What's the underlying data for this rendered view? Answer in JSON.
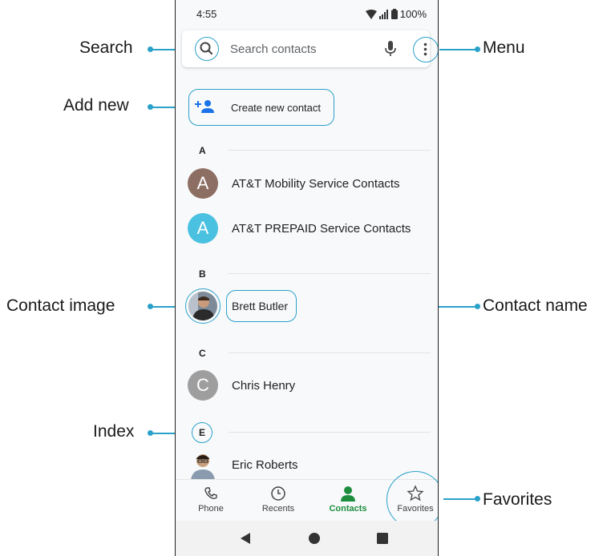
{
  "status_bar": {
    "time": "4:55",
    "battery": "100%"
  },
  "search": {
    "placeholder": "Search contacts"
  },
  "create_contact": {
    "label": "Create new contact"
  },
  "sections": [
    {
      "letter": "A",
      "contacts": [
        {
          "name": "AT&T Mobility Service Contacts",
          "initial": "A",
          "avatar_color": "#8d6e63"
        },
        {
          "name": "AT&T PREPAID Service Contacts",
          "initial": "A",
          "avatar_color": "#4ac1e0"
        }
      ]
    },
    {
      "letter": "B",
      "contacts": [
        {
          "name": "Brett Butler",
          "avatar": "photo"
        }
      ]
    },
    {
      "letter": "C",
      "contacts": [
        {
          "name": "Chris Henry",
          "initial": "C",
          "avatar_color": "#9e9e9e"
        }
      ]
    },
    {
      "letter": "E",
      "contacts": [
        {
          "name": "Eric Roberts",
          "avatar": "photo"
        }
      ]
    }
  ],
  "bottom_nav": [
    {
      "label": "Phone",
      "icon": "phone-icon"
    },
    {
      "label": "Recents",
      "icon": "clock-icon"
    },
    {
      "label": "Contacts",
      "icon": "person-icon",
      "active": true
    },
    {
      "label": "Favorites",
      "icon": "star-icon"
    }
  ],
  "annotations": {
    "search": "Search",
    "menu": "Menu",
    "add_new": "Add new",
    "contact_image": "Contact image",
    "contact_name": "Contact name",
    "index": "Index",
    "favorites": "Favorites"
  },
  "colors": {
    "accent": "#2aa1c9",
    "active_nav": "#1e8e3e"
  }
}
